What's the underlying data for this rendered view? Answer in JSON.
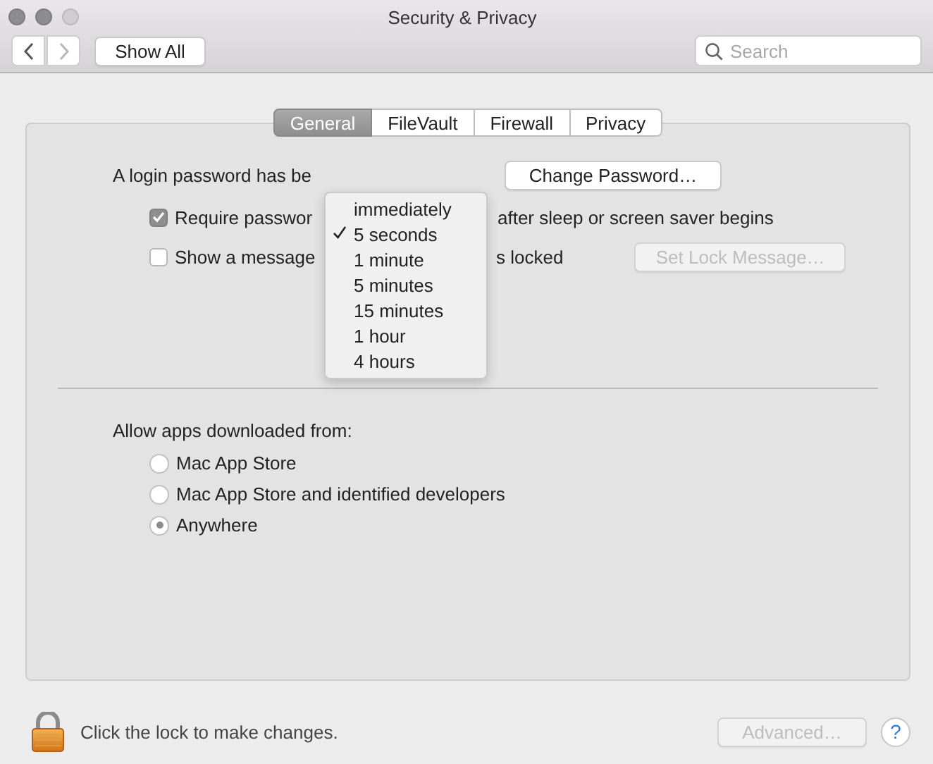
{
  "window": {
    "title": "Security & Privacy"
  },
  "toolbar": {
    "nav": [
      {
        "kind": "back",
        "disabled": false
      },
      {
        "kind": "forward",
        "disabled": true
      }
    ],
    "show_all": "Show All",
    "search": {
      "placeholder": "Search"
    }
  },
  "tabs": [
    {
      "label": "General",
      "selected": true
    },
    {
      "label": "FileVault",
      "selected": false
    },
    {
      "label": "Firewall",
      "selected": false
    },
    {
      "label": "Privacy",
      "selected": false
    }
  ],
  "general": {
    "password_text": "A login password has be",
    "change_password": "Change Password…",
    "require_password": {
      "checked": true,
      "label": "Require passwor",
      "suffix": "after sleep or screen saver begins"
    },
    "show_message": {
      "checked": false,
      "label": "Show a message",
      "suffix": "s locked"
    },
    "set_lock_message": {
      "label": "Set Lock Message…",
      "disabled": true
    }
  },
  "delay_menu": {
    "items": [
      {
        "label": "immediately",
        "selected": false
      },
      {
        "label": "5 seconds",
        "selected": true
      },
      {
        "label": "1 minute",
        "selected": false
      },
      {
        "label": "5 minutes",
        "selected": false
      },
      {
        "label": "15 minutes",
        "selected": false
      },
      {
        "label": "1 hour",
        "selected": false
      },
      {
        "label": "4 hours",
        "selected": false
      }
    ]
  },
  "downloads": {
    "label": "Allow apps downloaded from:",
    "options": [
      {
        "label": "Mac App Store",
        "selected": false
      },
      {
        "label": "Mac App Store and identified developers",
        "selected": false
      },
      {
        "label": "Anywhere",
        "selected": true
      }
    ]
  },
  "footer": {
    "lock_text": "Click the lock to make changes.",
    "advanced": {
      "label": "Advanced…",
      "disabled": true
    },
    "help": "?"
  }
}
